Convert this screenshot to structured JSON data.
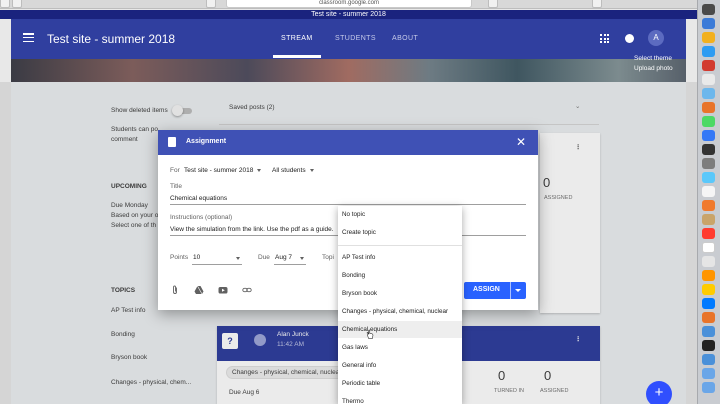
{
  "browser": {
    "url": "classroom.google.com",
    "tab_title": "Test site - summer 2018"
  },
  "appbar": {
    "class_name": "Test site - summer 2018",
    "nav": [
      "STREAM",
      "STUDENTS",
      "ABOUT"
    ],
    "active_nav": "STREAM",
    "avatar_letter": "A"
  },
  "banner": {
    "select_theme": "Select theme",
    "upload_photo": "Upload photo"
  },
  "page": {
    "show_deleted": "Show deleted items",
    "students_can_post": "Students can po",
    "comment": "comment",
    "saved_posts": "Saved posts (2)",
    "upcoming_title": "UPCOMING",
    "due_monday": "Due Monday",
    "based_on": "Based on your o",
    "select_one": "Select one of th",
    "topics_title": "TOPICS",
    "topics": [
      "AP Test info",
      "Bonding",
      "Bryson book",
      "Changes - physical, chem..."
    ],
    "count_assigned": "0",
    "assigned_label": "ASSIGNED",
    "post_author": "Alan Junck",
    "post_time": "11:42 AM",
    "post_topic_chip": "Changes - physical, chemical, nuclear",
    "post_due": "Due Aug 6",
    "turned_in_count": "0",
    "turned_in_label": "TURNED IN",
    "assigned_count2": "0",
    "assigned_label2": "ASSIGNED"
  },
  "dialog": {
    "title": "Assignment",
    "for_label": "For",
    "for_class": "Test site - summer 2018",
    "for_students": "All students",
    "title_label": "Title",
    "title_value": "Chemical equations",
    "instructions_label": "Instructions (optional)",
    "instructions_value": "View the simulation from the link.  Use the pdf as a guide.",
    "points_label": "Points",
    "points_value": "10",
    "due_label": "Due",
    "due_value": "Aug 7",
    "topic_label": "Topi",
    "assign_label": "ASSIGN"
  },
  "topic_menu": {
    "items": [
      "No topic",
      "Create topic",
      "AP Test info",
      "Bonding",
      "Bryson book",
      "Changes - physical, chemical, nuclear",
      "Chemical equations",
      "Gas laws",
      "General info",
      "Periodic table",
      "Thermo"
    ],
    "hovered": "Chemical equations"
  },
  "fab_label": "+",
  "colors": {
    "primary": "#303f9f",
    "dialog_header": "#3f51b5",
    "assign_button": "#2962ff"
  },
  "icons": [
    "menu-icon",
    "apps-icon",
    "notifications-icon",
    "assignment-icon",
    "close-icon",
    "attachment-icon",
    "google-drive-icon",
    "youtube-icon",
    "link-icon"
  ]
}
